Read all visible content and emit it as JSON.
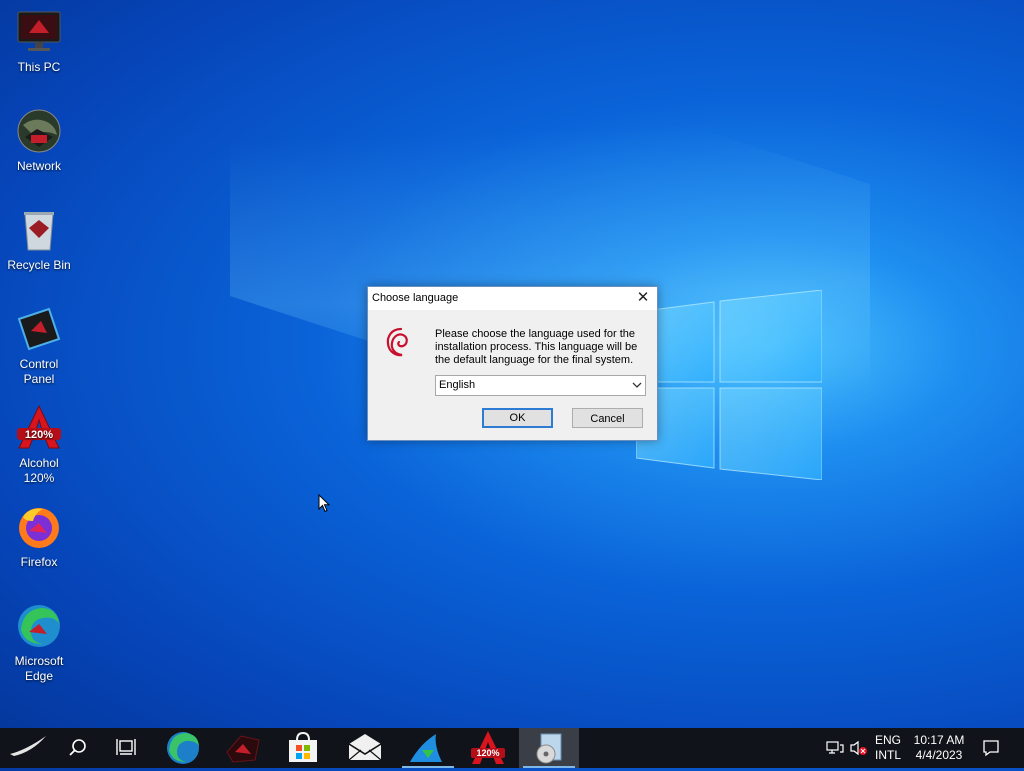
{
  "desktop": {
    "icons": [
      {
        "label": "This PC",
        "icon": "monitor-icon"
      },
      {
        "label": "Network",
        "icon": "globe-icon"
      },
      {
        "label": "Recycle Bin",
        "icon": "recycle-bin-icon"
      },
      {
        "label": "Control\nPanel",
        "icon": "control-panel-icon"
      },
      {
        "label": "Alcohol\n120%",
        "icon": "alcohol-icon"
      },
      {
        "label": "Firefox",
        "icon": "firefox-icon"
      },
      {
        "label": "Microsoft\nEdge",
        "icon": "edge-icon"
      }
    ]
  },
  "dialog": {
    "title": "Choose language",
    "message": "Please choose the language used for the installation process. This language will be the default language for the final system.",
    "language_value": "English",
    "ok_label": "OK",
    "cancel_label": "Cancel",
    "logo": "debian-swirl-icon"
  },
  "taskbar": {
    "items": [
      "start-icon",
      "search-icon",
      "task-view-icon",
      "edge-icon",
      "asus-rog-icon",
      "store-icon",
      "mail-icon",
      "installer-shark-icon",
      "alcohol-icon",
      "setup-cd-icon"
    ],
    "active_item": "setup-cd-icon",
    "language_top": "ENG",
    "language_bottom": "INTL",
    "time": "10:17 AM",
    "date": "4/4/2023"
  },
  "colors": {
    "desktop_blue": "#0a63d8",
    "taskbar": "#101319",
    "accent": "#2e7bd6"
  }
}
